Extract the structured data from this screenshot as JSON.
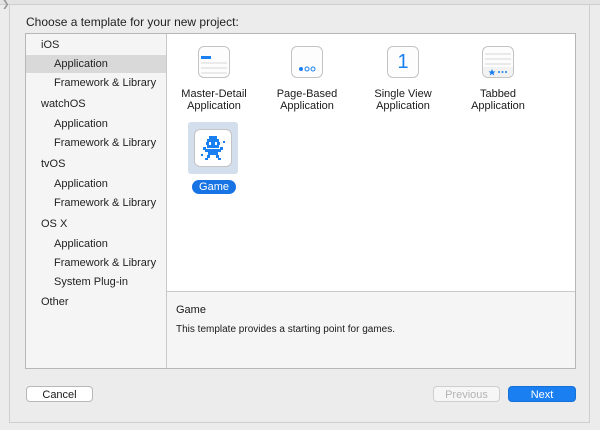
{
  "window": {
    "top_left_glyph": "❯"
  },
  "heading": "Choose a template for your new project:",
  "sidebar": {
    "groups": [
      {
        "label": "iOS",
        "items": [
          "Application",
          "Framework & Library"
        ]
      },
      {
        "label": "watchOS",
        "items": [
          "Application",
          "Framework & Library"
        ]
      },
      {
        "label": "tvOS",
        "items": [
          "Application",
          "Framework & Library"
        ]
      },
      {
        "label": "OS X",
        "items": [
          "Application",
          "Framework & Library",
          "System Plug-in"
        ]
      },
      {
        "label": "Other",
        "items": []
      }
    ],
    "selected": "iOS / Application"
  },
  "templates": [
    {
      "line1": "Master-Detail",
      "line2": "Application",
      "icon": "master-detail-icon"
    },
    {
      "line1": "Page-Based",
      "line2": "Application",
      "icon": "page-based-icon"
    },
    {
      "line1": "Single View",
      "line2": "Application",
      "icon": "single-view-icon",
      "icon_text": "1"
    },
    {
      "line1": "Tabbed",
      "line2": "Application",
      "icon": "tabbed-icon"
    },
    {
      "line1": "Game",
      "line2": "",
      "icon": "game-icon",
      "selected": true
    }
  ],
  "description": {
    "title": "Game",
    "text": "This template provides a starting point for games."
  },
  "buttons": {
    "cancel": "Cancel",
    "previous": "Previous",
    "next": "Next"
  },
  "colors": {
    "accent": "#1a7ff0",
    "selection_pill": "#1874e4",
    "selection_bg": "#d4dfed",
    "sidebar_selected": "#d9d9d9"
  }
}
